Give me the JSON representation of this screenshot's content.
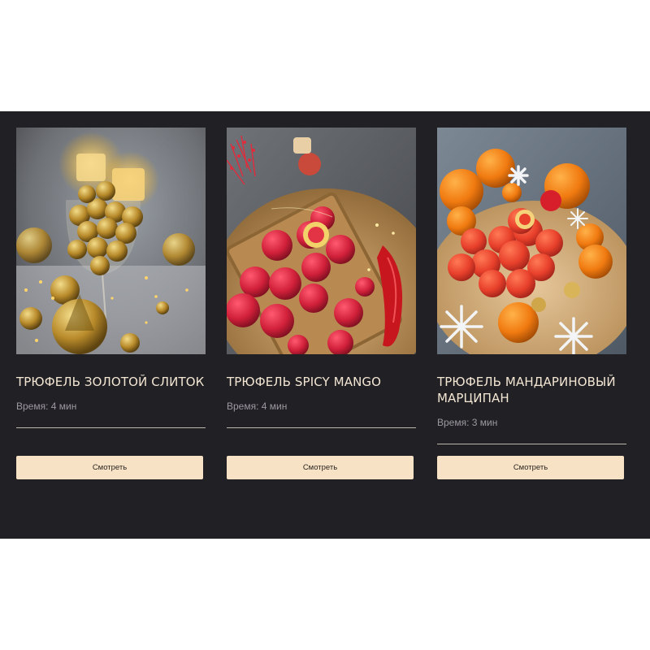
{
  "cards": [
    {
      "title": "Трюфель Золотой слиток",
      "time": "Время: 4 мин",
      "button_label": "Смотреть",
      "photo_icon": "gold-truffles-photo"
    },
    {
      "title": "Трюфель Spicy Mango",
      "time": "Время: 4 мин",
      "button_label": "Смотреть",
      "photo_icon": "red-truffles-photo"
    },
    {
      "title": "Трюфель Мандариновый марципан",
      "time": "Время: 3 мин",
      "button_label": "Смотреть",
      "photo_icon": "tangerine-truffles-photo"
    }
  ],
  "colors": {
    "section_bg": "#212025",
    "title": "#f3e6d3",
    "button_bg": "#f8e2c6",
    "divider": "#bdb6aa"
  }
}
